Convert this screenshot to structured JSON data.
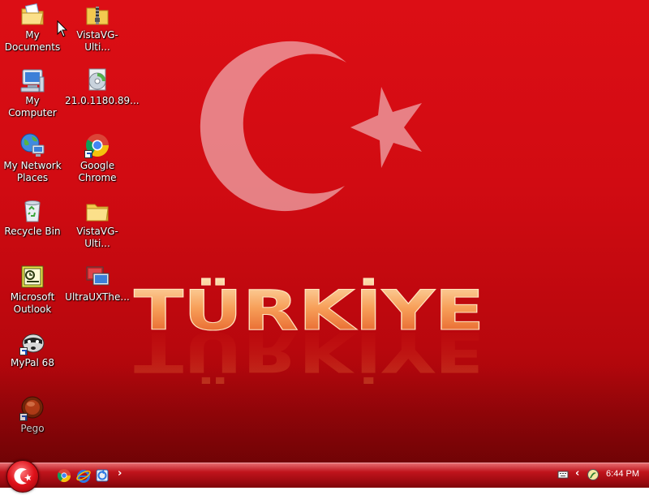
{
  "wallpaper": {
    "word": "TÜRKİYE"
  },
  "desktop_icons": [
    {
      "label": "My Documents",
      "icon": "my-documents-icon"
    },
    {
      "label": "VistaVG-Ulti...",
      "icon": "zip-archive-icon"
    },
    {
      "label": "My Computer",
      "icon": "my-computer-icon"
    },
    {
      "label": "21.0.1180.89...",
      "icon": "installer-disc-icon"
    },
    {
      "label": "My Network Places",
      "icon": "network-places-icon"
    },
    {
      "label": "Google Chrome",
      "icon": "chrome-icon"
    },
    {
      "label": "Recycle Bin",
      "icon": "recycle-bin-icon"
    },
    {
      "label": "VistaVG-Ulti...",
      "icon": "folder-icon"
    },
    {
      "label": "Microsoft Outlook",
      "icon": "outlook-icon"
    },
    {
      "label": "UltraUXThe...",
      "icon": "theme-patcher-icon"
    },
    {
      "label": "MyPal 68",
      "icon": "mypal-icon"
    },
    {
      "label": "Pego",
      "icon": "pego-icon"
    }
  ],
  "taskbar": {
    "start": "start-orb-icon",
    "quick_launch": [
      "chrome-icon",
      "internet-explorer-icon",
      "windows-update-icon"
    ],
    "overflow": "›",
    "tray_icons": [
      "keyboard-icon",
      "tray-expand-icon",
      "tray-app-icon"
    ],
    "tray_expand": "‹",
    "clock": "6:44 PM"
  }
}
